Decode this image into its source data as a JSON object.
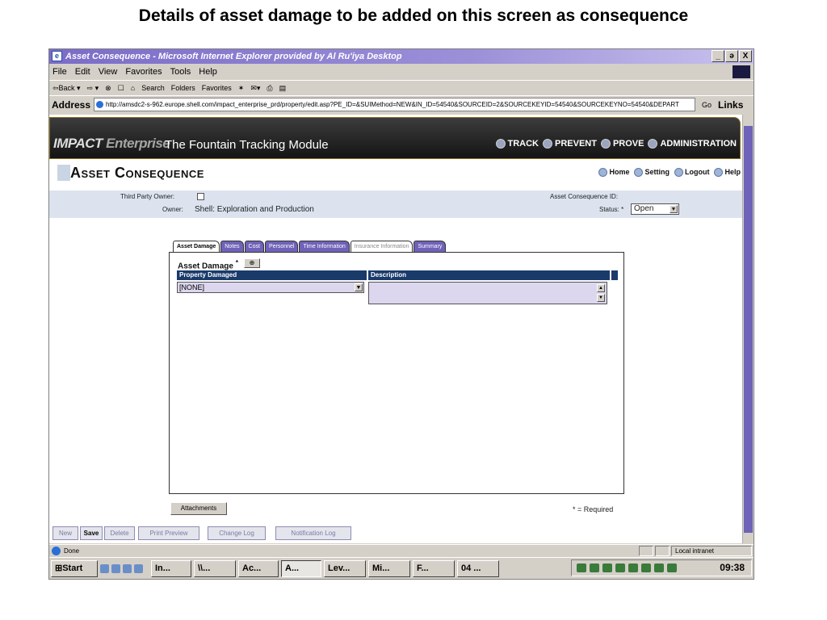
{
  "slide_title": "Details of asset damage to be added on this screen as consequence",
  "window": {
    "title": "Asset Consequence - Microsoft Internet Explorer provided by Al Ru'iya Desktop",
    "controls": [
      "_",
      "ə",
      "X"
    ]
  },
  "menu": [
    "File",
    "Edit",
    "View",
    "Favorites",
    "Tools",
    "Help"
  ],
  "toolbar": [
    "⇦Back ▾",
    "⇨ ▾",
    "⊗",
    "☐",
    "⌂",
    "Search",
    "Folders",
    "Favorites",
    "✶",
    "✉▾",
    "⎙",
    "▤"
  ],
  "address": {
    "label": "Address",
    "url": "http://amsdc2-s-962.europe.shell.com/impact_enterprise_prd/property/edit.asp?PE_ID=&SUIMethod=NEW&IN_ID=54540&SOURCEID=2&SOURCEKEYID=54540&SOURCEKEYNO=54540&DEPART",
    "go": "Go",
    "links": "Links"
  },
  "banner": {
    "logo_main": "IMPACT",
    "logo_sub": "Enterprise",
    "module": "The Fountain Tracking Module",
    "nav": [
      "TRACK",
      "PREVENT",
      "PROVE",
      "ADMINISTRATION"
    ]
  },
  "page": {
    "title": "Asset Consequence",
    "links": [
      "Home",
      "Setting",
      "Logout",
      "Help"
    ]
  },
  "info": {
    "third_party_label": "Third Party Owner:",
    "owner_label": "Owner:",
    "owner_value": "Shell: Exploration and Production",
    "id_label": "Asset Consequence ID:",
    "status_label": "Status: *",
    "status_value": "Open"
  },
  "tabs": [
    "Asset Damage",
    "Notes",
    "Cost",
    "Personnel",
    "Time Information",
    "Insurance Information",
    "Summary"
  ],
  "form": {
    "section_label": "Asset Damage",
    "required_mark": "*",
    "add_icon": "⊕",
    "col_property": "Property Damaged",
    "col_description": "Description",
    "property_value": "[NONE]"
  },
  "attachments_label": "Attachments",
  "required_note": "* = Required",
  "actions": [
    "New",
    "Save",
    "Delete",
    "Print Preview",
    "Change Log",
    "Notification Log"
  ],
  "statusbar": {
    "text": "Done",
    "zone": "Local intranet"
  },
  "taskbar": {
    "start": "Start",
    "tasks": [
      "In...",
      "\\\\...",
      "Ac...",
      "A...",
      "Lev...",
      "Mi...",
      "F...",
      "04 ..."
    ],
    "time": "09:38"
  }
}
